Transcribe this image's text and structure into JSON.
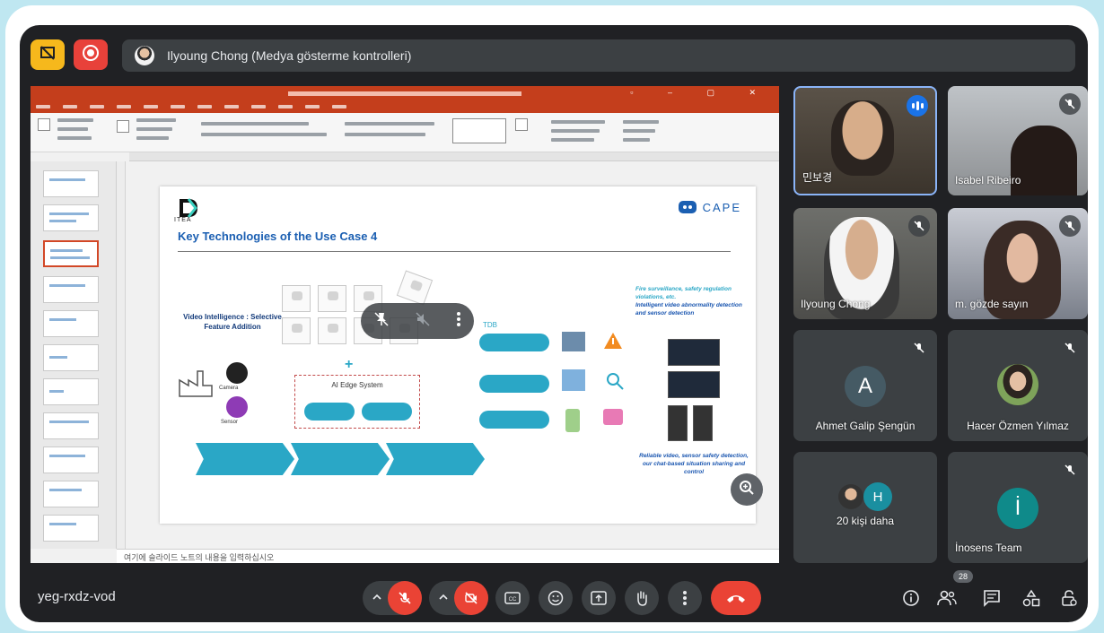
{
  "topbar": {
    "presenter_text": "Ilyoung Chong (Medya gösterme kontrolleri)"
  },
  "slide": {
    "title": "Key Technologies of the Use Case 4",
    "itea_label": "ITEA",
    "cape_label": "CAPE",
    "video_intelligence_label": "Video Intelligence : Selective Feature Addition",
    "ai_system_label": "AI Edge System",
    "bullets": [
      "Fire surveillance, safety regulation violations, etc.",
      "Intelligent video abnormality detection and sensor detection"
    ],
    "bottom_note": "Reliable video, sensor safety detection, our chat-based situation sharing and control",
    "tdb_label": "TDB",
    "camera_label": "Camera",
    "sensor_label": "Sensor"
  },
  "ppt": {
    "notes_placeholder": "여기에 슬라이드 노트의 내용을 입력하십시오"
  },
  "participants": [
    {
      "name": "민보경",
      "state": "speaking"
    },
    {
      "name": "Isabel Ribeiro",
      "state": "muted"
    },
    {
      "name": "Ilyoung Chong",
      "state": "muted"
    },
    {
      "name": "m. gözde sayın",
      "state": "muted"
    },
    {
      "name": "Ahmet Galip Şengün",
      "initial": "A",
      "state": "muted"
    },
    {
      "name": "Hacer Özmen Yılmaz",
      "state": "muted"
    },
    {
      "name": "20 kişi daha",
      "initial": "H"
    },
    {
      "name": "İnosens Team",
      "initial": "İ",
      "state": "muted"
    }
  ],
  "bottombar": {
    "meeting_code": "yeg-rxdz-vod",
    "participant_count": "28"
  },
  "colors": {
    "meet_bg": "#202124",
    "control_dark": "#3c4043",
    "danger": "#ea4335",
    "accent": "#1a73e8",
    "ppt_red": "#c43e1c",
    "slide_blue": "#1b5fb2",
    "teal": "#2aa7c6"
  },
  "icons": {
    "present_off": "present-off-icon",
    "record": "record-icon",
    "mic_off": "mic-off-icon",
    "camera_off": "camera-off-icon",
    "captions": "captions-icon",
    "emoji": "emoji-icon",
    "present": "present-icon",
    "hand": "raise-hand-icon",
    "more": "more-vert-icon",
    "end_call": "end-call-icon",
    "info": "info-icon",
    "people": "people-icon",
    "chat": "chat-icon",
    "activities": "activities-icon",
    "host_controls": "host-controls-icon"
  }
}
